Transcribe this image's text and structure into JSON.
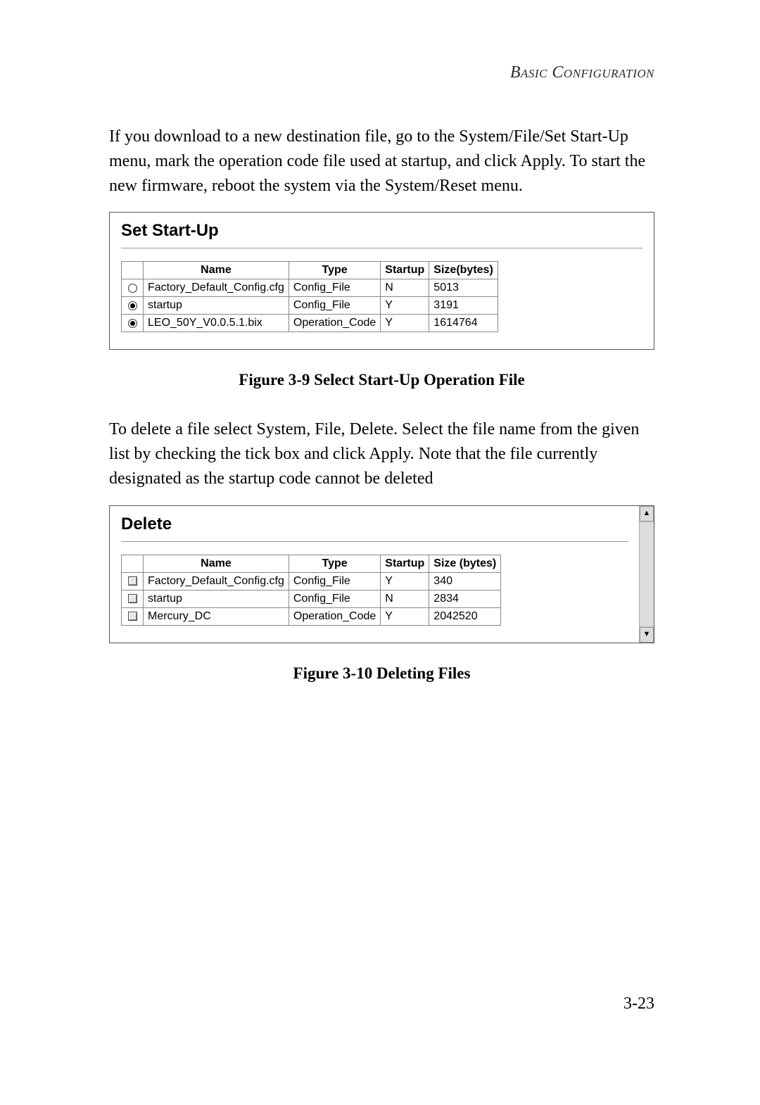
{
  "header": {
    "running_head": "Basic Configuration"
  },
  "para1": "If you download to a new destination file, go to the System/File/Set Start-Up menu, mark the operation code file used at startup, and click Apply. To start the new firmware, reboot the system via the System/Reset menu.",
  "figure1": {
    "title": "Set Start-Up",
    "columns": {
      "name": "Name",
      "type": "Type",
      "startup": "Startup",
      "size": "Size(bytes)"
    },
    "rows": [
      {
        "selected": false,
        "name": "Factory_Default_Config.cfg",
        "type": "Config_File",
        "startup": "N",
        "size": "5013"
      },
      {
        "selected": true,
        "name": "startup",
        "type": "Config_File",
        "startup": "Y",
        "size": "3191"
      },
      {
        "selected": true,
        "name": "LEO_50Y_V0.0.5.1.bix",
        "type": "Operation_Code",
        "startup": "Y",
        "size": "1614764"
      }
    ],
    "caption": "Figure 3-9  Select Start-Up Operation File"
  },
  "para2": "To delete a file select System, File, Delete. Select the file name from the given list by checking the tick box and click Apply. Note that the file currently designated as the startup code cannot be deleted",
  "figure2": {
    "title": "Delete",
    "columns": {
      "name": "Name",
      "type": "Type",
      "startup": "Startup",
      "size": "Size (bytes)"
    },
    "rows": [
      {
        "name": "Factory_Default_Config.cfg",
        "type": "Config_File",
        "startup": "Y",
        "size": "340"
      },
      {
        "name": "startup",
        "type": "Config_File",
        "startup": "N",
        "size": "2834"
      },
      {
        "name": "Mercury_DC",
        "type": "Operation_Code",
        "startup": "Y",
        "size": "2042520"
      }
    ],
    "caption": "Figure 3-10  Deleting Files"
  },
  "page_number": "3-23"
}
